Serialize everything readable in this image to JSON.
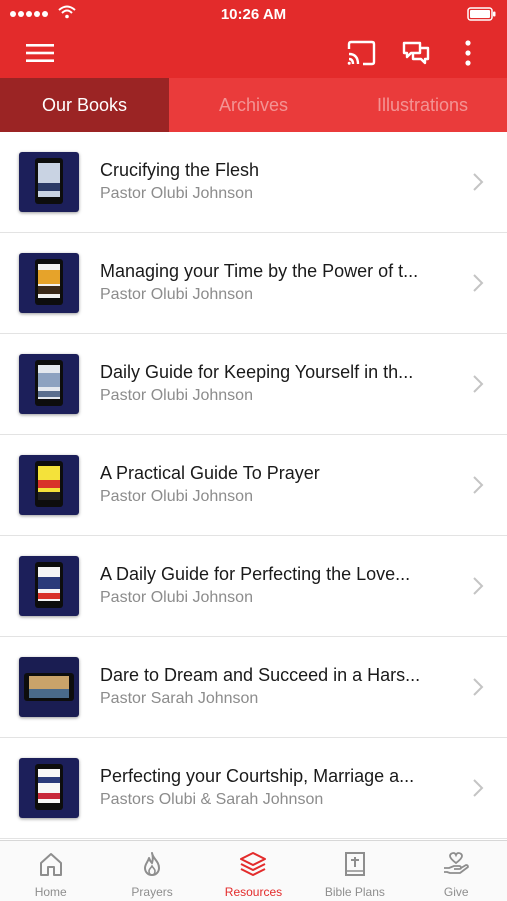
{
  "status_bar": {
    "time": "10:26 AM"
  },
  "header": {
    "menu_icon": "hamburger-icon",
    "cast_icon": "cast-icon",
    "chat_icon": "chat-bubbles-icon",
    "more_icon": "more-vertical-icon"
  },
  "tabs": [
    {
      "label": "Our Books",
      "active": true
    },
    {
      "label": "Archives",
      "active": false
    },
    {
      "label": "Illustrations",
      "active": false
    }
  ],
  "books": [
    {
      "title": "Crucifying the Flesh",
      "author": "Pastor Olubi Johnson"
    },
    {
      "title": "Managing your Time by the Power of t...",
      "author": "Pastor Olubi Johnson"
    },
    {
      "title": "Daily Guide for Keeping Yourself in th...",
      "author": "Pastor Olubi Johnson"
    },
    {
      "title": "A Practical Guide To Prayer",
      "author": "Pastor Olubi Johnson"
    },
    {
      "title": "A Daily Guide for Perfecting the Love...",
      "author": "Pastor Olubi Johnson"
    },
    {
      "title": "Dare to Dream and Succeed in a Hars...",
      "author": "Pastor Sarah Johnson"
    },
    {
      "title": "Perfecting your Courtship, Marriage a...",
      "author": "Pastors Olubi & Sarah Johnson"
    }
  ],
  "tabbar": [
    {
      "label": "Home",
      "icon": "home-icon",
      "active": false
    },
    {
      "label": "Prayers",
      "icon": "flame-icon",
      "active": false
    },
    {
      "label": "Resources",
      "icon": "layers-icon",
      "active": true
    },
    {
      "label": "Bible Plans",
      "icon": "bible-icon",
      "active": false
    },
    {
      "label": "Give",
      "icon": "give-hand-icon",
      "active": false
    }
  ],
  "colors": {
    "brand_red": "#e32b2b",
    "active_tab": "#9b2424",
    "tab_bar_active": "#e32b2b",
    "tab_bar_inactive": "#8e8e8e"
  }
}
